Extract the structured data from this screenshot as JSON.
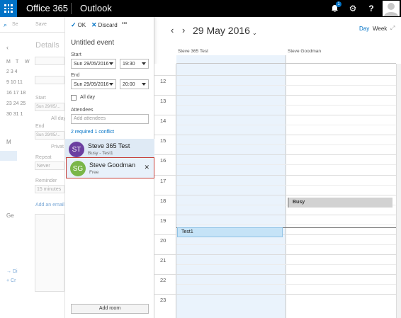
{
  "topbar": {
    "app_name": "Office 365",
    "product": "Outlook",
    "notification_count": "1",
    "help_glyph": "?",
    "settings_glyph": "⚙"
  },
  "background": {
    "save": "Save",
    "details": "Details",
    "start": "Start",
    "end": "End",
    "start_value": "Sun 29/05/...",
    "end_value": "Sun 29/05/...",
    "all_day": "All day",
    "private": "Privat",
    "repeat": "Repeat",
    "repeat_value": "Never",
    "reminder": "Reminder",
    "reminder_value": "15 minutes",
    "add_email": "Add an email r",
    "section_m": "M",
    "section_g": "Ge",
    "month_letters": [
      "M",
      "T",
      "W"
    ],
    "month_rows": [
      "2 3 4",
      "9 10 11",
      "16 17 18",
      "23 24 25",
      "30 31 1"
    ]
  },
  "panel": {
    "ok_label": "OK",
    "discard_label": "Discard",
    "more_label": "•••",
    "event_title": "Untitled event",
    "start_label": "Start",
    "start_date": "Sun 29/05/2016",
    "start_time": "19:30",
    "end_label": "End",
    "end_date": "Sun 29/05/2016",
    "end_time": "20:00",
    "all_day": "All day",
    "attendees_label": "Attendees",
    "attendees_placeholder": "Add attendees",
    "conflict_link": "2 required 1 conflict",
    "add_room": "Add room"
  },
  "attendees": [
    {
      "initials": "ST",
      "name": "Steve 365 Test",
      "status": "Busy - Test1",
      "color": "#6b3fa0"
    },
    {
      "initials": "SG",
      "name": "Steve Goodman",
      "status": "Free",
      "color": "#7ab648",
      "close": "✕"
    }
  ],
  "calendar": {
    "date": "29 May 2016",
    "view_day": "Day",
    "view_week": "Week",
    "columns": [
      "Steve 365 Test",
      "Steve Goodman"
    ],
    "hours": [
      "12",
      "13",
      "14",
      "15",
      "16",
      "17",
      "18",
      "19",
      "20",
      "21",
      "22",
      "23"
    ],
    "events": {
      "busy": "Busy",
      "test1": "Test1"
    }
  },
  "colors": {
    "accent": "#0072c6",
    "selected_border": "#c7403a",
    "column_tint": "#eaf3fc"
  }
}
